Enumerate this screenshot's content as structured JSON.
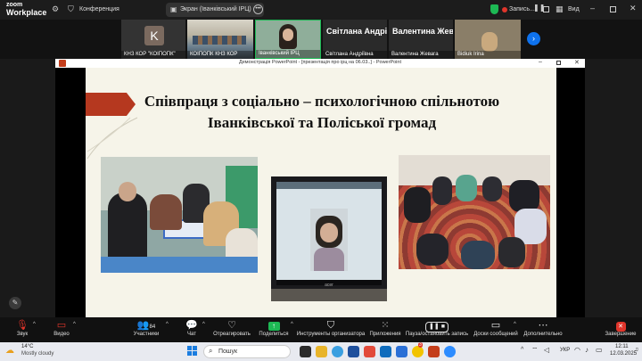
{
  "app": {
    "logo_line1": "zoom",
    "logo_line2": "Workplace",
    "meeting_label": "Конференция",
    "screen_share_label": "Экран (Іванківський ІРЦ)",
    "recording_label": "Запись...",
    "view_label": "Вид"
  },
  "participants": [
    {
      "initial": "K",
      "name": "КНЗ КОР \"КОІПОПК\""
    },
    {
      "initial": "",
      "name": "КОІПОПК КНЗ КОР"
    },
    {
      "initial": "",
      "name": "Іванківський ІРЦ"
    },
    {
      "initial": "",
      "big": "Світлана Андрії...",
      "name": "Світлана Андріївна"
    },
    {
      "initial": "",
      "big": "Валентина Жев...",
      "name": "Валентина Жевага"
    },
    {
      "initial": "",
      "name": "Bidiuk Irina"
    }
  ],
  "ppt": {
    "window_title": "Демонстрація PowerPoint - [презентація про ірц на 06.03..] - PowerPoint"
  },
  "slide": {
    "title": "Співпраця з соціально – психологічною спільнотою Іванківської та Поліської громад",
    "monitor_brand": "acer"
  },
  "toolbar": {
    "mute": "Звук",
    "video": "Видео",
    "participants": "Участники",
    "participants_count": "84",
    "chat": "Чат",
    "react": "Отреагировать",
    "share": "Поделиться",
    "host_tools": "Инструменты организатора",
    "apps": "Приложения",
    "pause_record": "Пауза/остановить запись",
    "whiteboards": "Доски сообщений",
    "more": "Дополнительно",
    "end": "Завершение"
  },
  "taskbar": {
    "weather_temp": "14°C",
    "weather_desc": "Mostly cloudy",
    "search_placeholder": "Пошук",
    "lang": "УКР",
    "time": "12:11",
    "date": "12.03.2025",
    "notif_count": "3"
  },
  "colors": {
    "accent_green": "#1db954",
    "zoom_blue": "#0e72ed",
    "end_red": "#e0352b",
    "slide_bg": "#f6f4e9",
    "arrow_red": "#b5381f"
  }
}
